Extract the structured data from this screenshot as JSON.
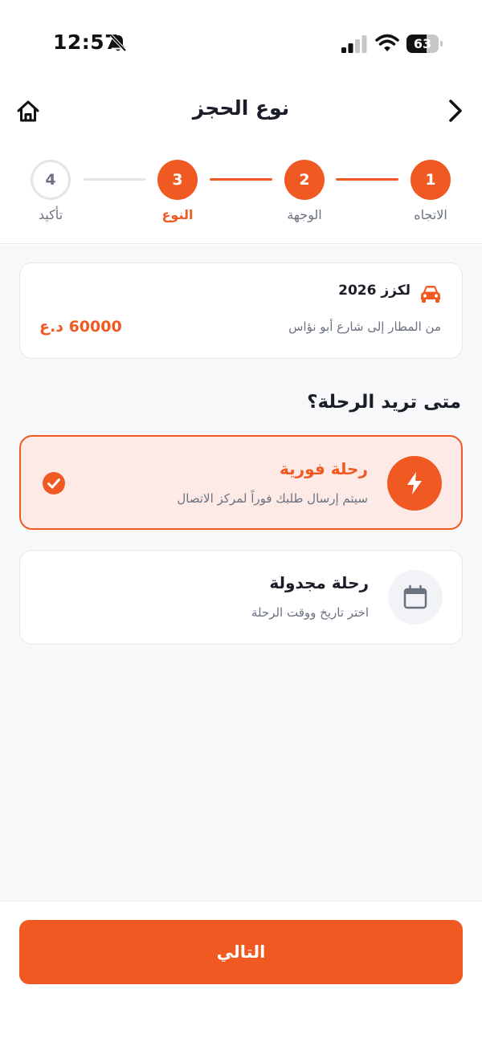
{
  "status_bar": {
    "time": "12:57",
    "battery_percent": 63,
    "battery_label": "63"
  },
  "header": {
    "title": "نوع الحجز"
  },
  "stepper": {
    "steps": [
      {
        "number": "1",
        "label": "الاتجاه",
        "state": "completed"
      },
      {
        "number": "2",
        "label": "الوجهة",
        "state": "completed"
      },
      {
        "number": "3",
        "label": "النوع",
        "state": "current"
      },
      {
        "number": "4",
        "label": "تأكيد",
        "state": "pending"
      }
    ]
  },
  "summary": {
    "car_name": "لكزز 2026",
    "route": "من المطار إلى شارع أبو نؤاس",
    "price": "60000 د.ع"
  },
  "question": "متى تريد الرحلة؟",
  "options": [
    {
      "title": "رحلة فورية",
      "description": "سيتم إرسال طلبك فوراً لمركز الاتصال",
      "icon": "lightning-icon",
      "selected": true
    },
    {
      "title": "رحلة مجدولة",
      "description": "اختر تاريخ ووقت الرحلة",
      "icon": "calendar-icon",
      "selected": false
    }
  ],
  "footer": {
    "next_label": "التالي"
  },
  "colors": {
    "accent": "#f05a22",
    "selected_bg": "#fdeae6",
    "text_dark": "#1b1e28",
    "text_muted": "#6b7280",
    "background": "#f7f8fa"
  }
}
